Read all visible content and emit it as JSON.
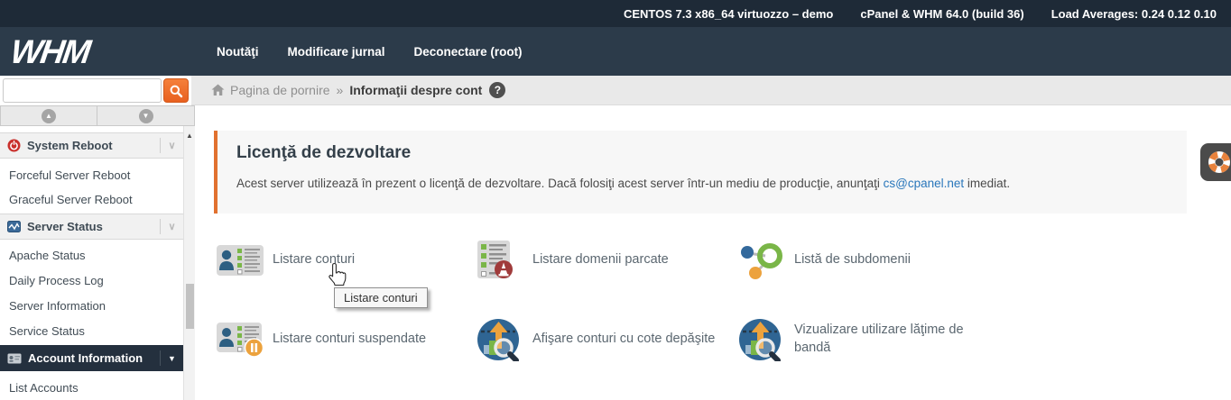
{
  "topbar": {
    "system_info": "CENTOS 7.3 x86_64 virtuozzo – demo",
    "version_info": "cPanel & WHM 64.0 (build 36)",
    "load_averages": "Load Averages: 0.24 0.12 0.10"
  },
  "navbar": {
    "logo_text": "WHM",
    "links": [
      {
        "label": "Noutăţi"
      },
      {
        "label": "Modificare jurnal"
      },
      {
        "label": "Deconectare (root)"
      }
    ]
  },
  "search": {
    "value": "",
    "placeholder": ""
  },
  "breadcrumb": {
    "home_label": "Pagina de pornire",
    "separator": "»",
    "current_label": "Informaţii despre cont"
  },
  "sidebar": {
    "items": [
      {
        "type": "group-header",
        "label": "System Reboot",
        "icon": "power-icon",
        "active": false
      },
      {
        "type": "link",
        "label": "Forceful Server Reboot"
      },
      {
        "type": "link",
        "label": "Graceful Server Reboot"
      },
      {
        "type": "group-header",
        "label": "Server Status",
        "icon": "chart-icon",
        "active": false
      },
      {
        "type": "link",
        "label": "Apache Status"
      },
      {
        "type": "link",
        "label": "Daily Process Log"
      },
      {
        "type": "link",
        "label": "Server Information"
      },
      {
        "type": "link",
        "label": "Service Status"
      },
      {
        "type": "group-header",
        "label": "Account Information",
        "icon": "id-card-icon",
        "active": true
      },
      {
        "type": "link",
        "label": "List Accounts"
      }
    ]
  },
  "license_panel": {
    "title": "Licenţă de dezvoltare",
    "body_before_link": "Acest server utilizează în prezent o licenţă de dezvoltare. Dacă folosiţi acest server într-un mediu de producţie, anunţaţi ",
    "link_text": "cs@cpanel.net",
    "body_after_link": " imediat."
  },
  "features": [
    {
      "label": "Listare conturi",
      "icon": "account-list-icon"
    },
    {
      "label": "Listare domenii parcate",
      "icon": "parked-domains-icon"
    },
    {
      "label": "Listă de subdomenii",
      "icon": "subdomains-icon"
    },
    {
      "label": "Listare conturi suspendate",
      "icon": "suspended-accounts-icon"
    },
    {
      "label": "Afişare conturi cu cote depăşite",
      "icon": "overquota-accounts-icon"
    },
    {
      "label": "Vizualizare utilizare lăţime de bandă",
      "icon": "bandwidth-usage-icon"
    }
  ],
  "tooltip": {
    "text": "Listare conturi"
  },
  "colors": {
    "accent_orange": "#ef6b2d",
    "panel_border_orange": "#e1712f",
    "topbar_bg": "#1e2a37",
    "navbar_bg": "#2c3b4a",
    "active_item_bg": "#24303e",
    "link_blue": "#2a77bb"
  }
}
